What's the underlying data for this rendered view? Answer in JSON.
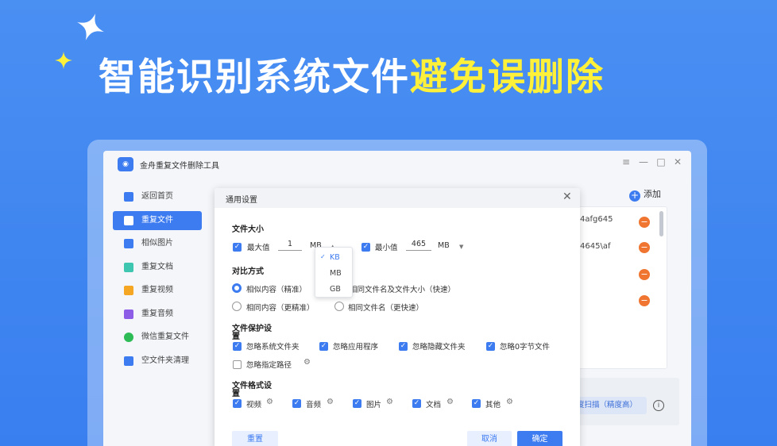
{
  "headline": {
    "part1": "智能识别系统文件",
    "part2": "避免误删除"
  },
  "colors": {
    "accent": "#3d7bf0",
    "highlight": "#fff13a",
    "danger": "#f07530"
  },
  "app": {
    "title": "金舟重复文件删除工具",
    "window_controls": [
      "≡",
      "—",
      "□",
      "✕"
    ],
    "add_label": "添加",
    "sidebar": [
      {
        "label": "返回首页",
        "icon": "home-icon",
        "color": "#3d7bf0"
      },
      {
        "label": "重复文件",
        "icon": "folder-icon",
        "color": "#ffffff",
        "active": true
      },
      {
        "label": "相似图片",
        "icon": "image-icon",
        "color": "#3d7bf0"
      },
      {
        "label": "重复文档",
        "icon": "document-icon",
        "color": "#3ec6b0"
      },
      {
        "label": "重复视频",
        "icon": "video-icon",
        "color": "#f5a623"
      },
      {
        "label": "重复音频",
        "icon": "audio-icon",
        "color": "#8e5de8"
      },
      {
        "label": "微信重复文件",
        "icon": "wechat-icon",
        "color": "#2dbb55"
      },
      {
        "label": "空文件夹清理",
        "icon": "empty-folder-icon",
        "color": "#3d7bf0"
      }
    ],
    "rows": [
      "4afg645",
      "4645\\af"
    ],
    "scan_button": "度扫描（精度高）",
    "info": "i"
  },
  "dialog": {
    "title": "通用设置",
    "close": "✕",
    "size": {
      "title": "文件大小",
      "max_label": "最大值",
      "max_value": "1",
      "max_unit": "MB",
      "min_label": "最小值",
      "min_value": "465",
      "min_unit": "MB",
      "unit_options": [
        "KB",
        "MB",
        "GB"
      ],
      "selected_unit": "KB"
    },
    "compare": {
      "title": "对比方式",
      "options": [
        "相似内容（精准）",
        "相同文件名及文件大小（快速）",
        "相同内容（更精准）",
        "相同文件名（更快速）"
      ]
    },
    "protect": {
      "title": "文件保护设置",
      "options": [
        "忽略系统文件夹",
        "忽略应用程序",
        "忽略隐藏文件夹",
        "忽略0字节文件",
        "忽略指定路径"
      ]
    },
    "formats": {
      "title": "文件格式设置",
      "options": [
        "视频",
        "音频",
        "图片",
        "文档",
        "其他"
      ]
    },
    "buttons": {
      "reset": "重置",
      "cancel": "取消",
      "confirm": "确定"
    }
  }
}
